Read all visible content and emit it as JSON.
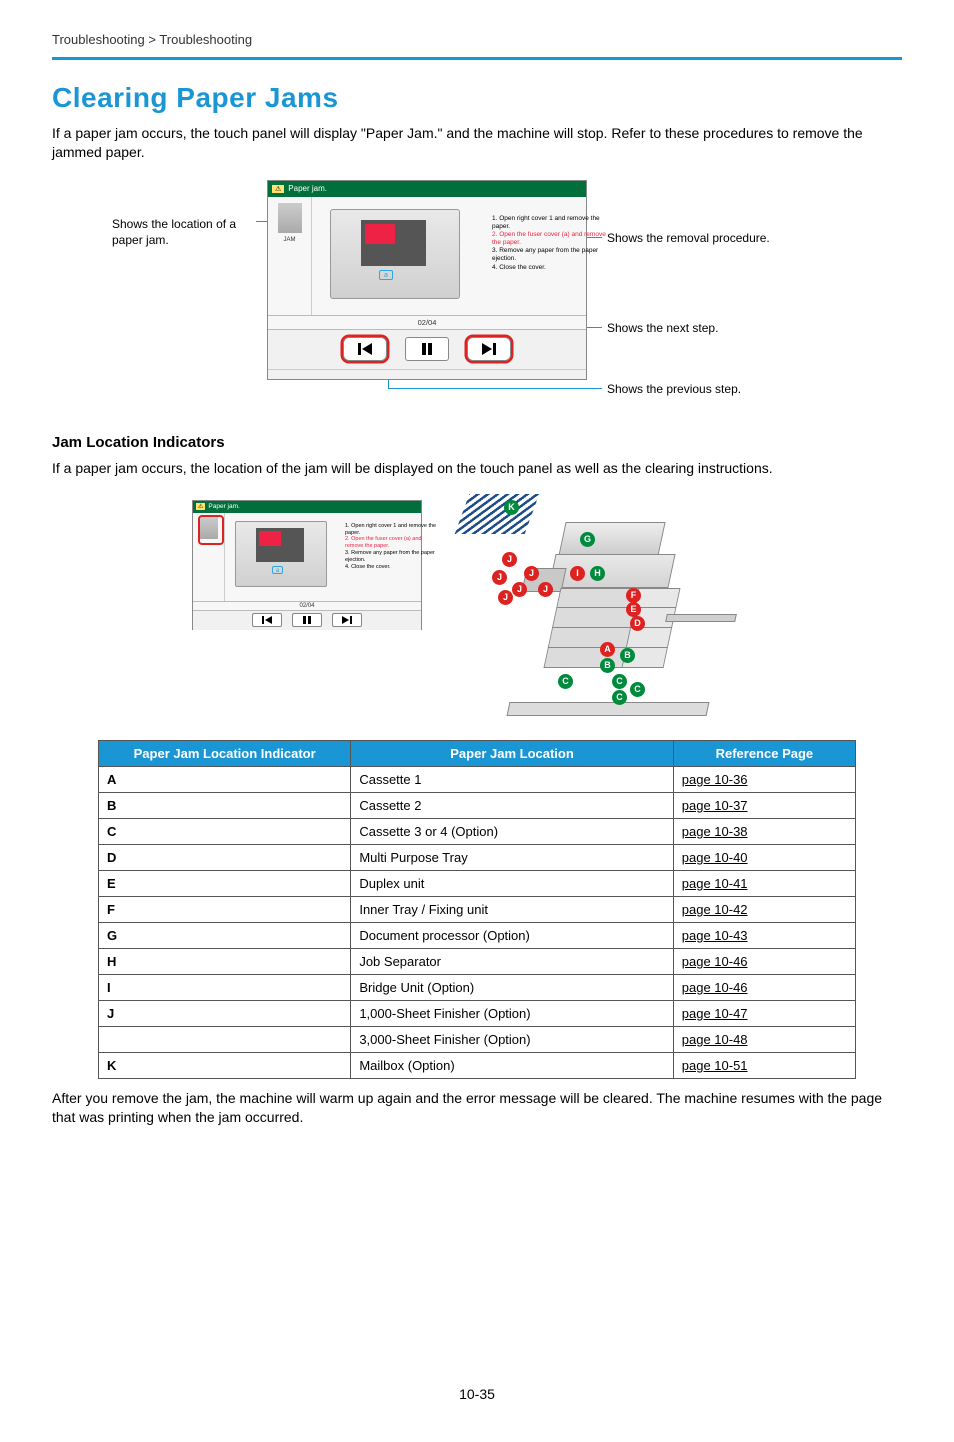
{
  "breadcrumb": "Troubleshooting > Troubleshooting",
  "title": "Clearing Paper Jams",
  "intro": "If a paper jam occurs, the touch panel will display \"Paper Jam.\" and the machine will stop. Refer to these procedures to remove the jammed paper.",
  "subhead": "Jam Location Indicators",
  "subintro": "If a paper jam occurs, the location of the jam will be displayed on the touch panel as well as the clearing instructions.",
  "callouts": {
    "left": "Shows the location of a paper jam.",
    "r1": "Shows the removal procedure.",
    "r2": "Shows the next step.",
    "r3": "Shows the previous step."
  },
  "touchpanel": {
    "attention_abbrev": "⚠",
    "header": "Paper jam.",
    "jam_label": "JAM",
    "steps": {
      "s1": "1. Open right cover 1 and remove the paper.",
      "s2": "2. Open the fuser cover (a) and remove the paper.",
      "s3": "3. Remove any paper from the paper ejection.",
      "s4": "4. Close the cover."
    },
    "amark": "a",
    "counter": "02/04"
  },
  "machine_labels": [
    "A",
    "B",
    "C",
    "D",
    "E",
    "F",
    "G",
    "H",
    "I",
    "J",
    "K"
  ],
  "table": {
    "headers": {
      "indicator": "Paper Jam Location Indicator",
      "location": "Paper Jam Location",
      "ref": "Reference Page"
    },
    "rows": [
      {
        "ind": "A",
        "loc": "Cassette 1",
        "ref": "page 10-36"
      },
      {
        "ind": "B",
        "loc": "Cassette 2",
        "ref": "page 10-37"
      },
      {
        "ind": "C",
        "loc": "Cassette 3 or 4 (Option)",
        "ref": "page 10-38"
      },
      {
        "ind": "D",
        "loc": "Multi Purpose Tray",
        "ref": "page 10-40"
      },
      {
        "ind": "E",
        "loc": "Duplex unit",
        "ref": "page 10-41"
      },
      {
        "ind": "F",
        "loc": "Inner Tray / Fixing unit",
        "ref": "page 10-42"
      },
      {
        "ind": "G",
        "loc": "Document processor (Option)",
        "ref": "page 10-43"
      },
      {
        "ind": "H",
        "loc": "Job Separator",
        "ref": "page 10-46"
      },
      {
        "ind": "I",
        "loc": "Bridge Unit (Option)",
        "ref": "page 10-46"
      },
      {
        "ind": "J",
        "loc": "1,000-Sheet Finisher (Option)",
        "ref": "page 10-47"
      },
      {
        "ind": "",
        "loc": "3,000-Sheet Finisher (Option)",
        "ref": "page 10-48"
      },
      {
        "ind": "K",
        "loc": "Mailbox (Option)",
        "ref": "page 10-51"
      }
    ]
  },
  "outro": "After you remove the jam, the machine will warm up again and the error message will be cleared. The machine resumes with the page that was printing when the jam occurred.",
  "page_number": "10-35"
}
